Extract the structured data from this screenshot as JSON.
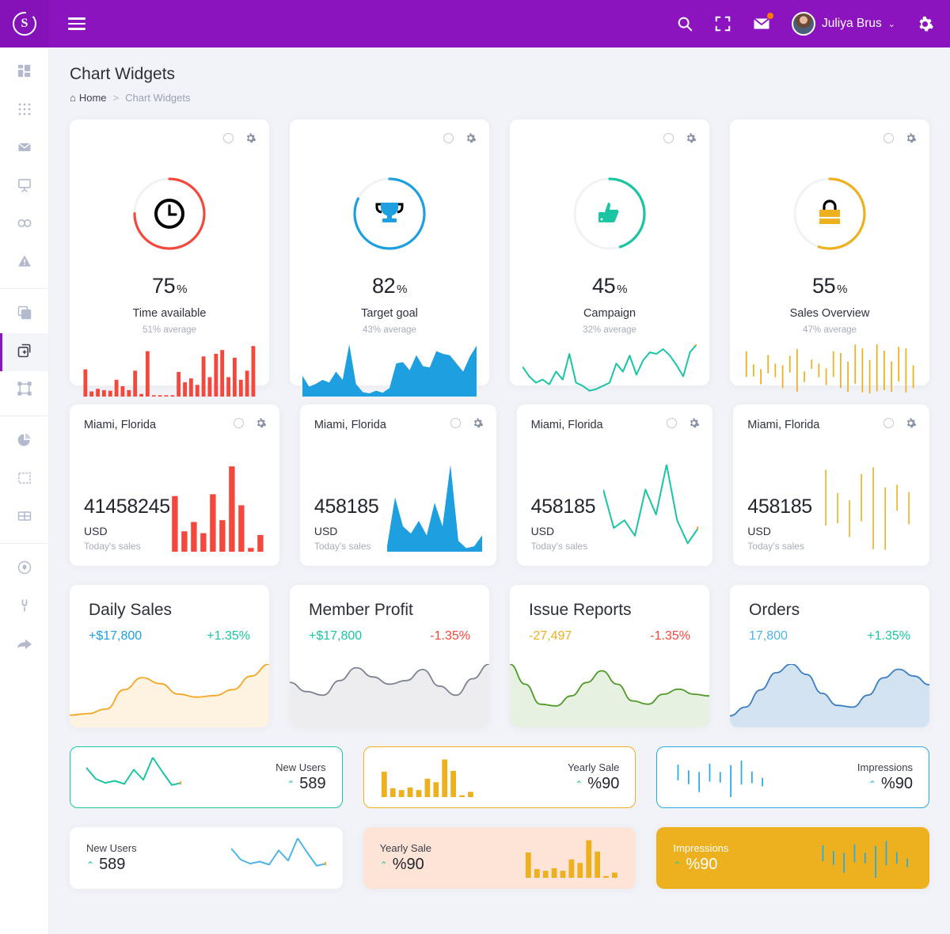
{
  "brand": {
    "logo_letter": "S",
    "primary": "#8c14bf"
  },
  "topbar": {
    "menu_toggle": "menu-toggle",
    "search_label": "Search",
    "fullscreen_label": "Fullscreen",
    "mail_label": "Messages",
    "user_name": "Juliya Brus",
    "caret": "⌄",
    "settings_label": "Settings"
  },
  "sidebar": {
    "items": [
      {
        "name": "dashboard",
        "icon": "layout-dashboard-icon",
        "active": false
      },
      {
        "name": "apps-grid",
        "icon": "grid-apps-icon",
        "active": false
      },
      {
        "name": "mail",
        "icon": "envelope-icon",
        "active": false
      },
      {
        "name": "presentation",
        "icon": "presentation-board-icon",
        "active": false
      },
      {
        "name": "infinity",
        "icon": "infinity-icon",
        "active": false
      },
      {
        "name": "alerts",
        "icon": "warning-triangle-icon",
        "active": false
      },
      {
        "name": "layers",
        "icon": "copy-layers-icon",
        "active": false
      },
      {
        "name": "widgets",
        "icon": "widget-copy-icon",
        "active": true
      },
      {
        "name": "components",
        "icon": "bounding-box-icon",
        "active": false
      },
      {
        "name": "charts",
        "icon": "pie-chart-icon",
        "active": false
      },
      {
        "name": "media",
        "icon": "image-frame-icon",
        "active": false
      },
      {
        "name": "tables",
        "icon": "table-grid-icon",
        "active": false
      },
      {
        "name": "maps",
        "icon": "location-pin-icon",
        "active": false
      },
      {
        "name": "plugins",
        "icon": "plug-icon",
        "active": false
      },
      {
        "name": "share",
        "icon": "arrow-share-icon",
        "active": false
      }
    ]
  },
  "page": {
    "title": "Chart Widgets",
    "breadcrumb": {
      "home": "Home",
      "separator": ">",
      "current": "Chart Widgets"
    }
  },
  "gauge_cards": [
    {
      "value": "75",
      "unit": "%",
      "label": "Time available",
      "sub": "51% average",
      "color": "#f4483c",
      "icon": "clock-icon",
      "percent": 75,
      "spark_type": "bar"
    },
    {
      "value": "82",
      "unit": "%",
      "label": "Target goal",
      "sub": "43% average",
      "color": "#1d9fe0",
      "icon": "trophy-icon",
      "percent": 82,
      "spark_type": "area"
    },
    {
      "value": "45",
      "unit": "%",
      "label": "Campaign",
      "sub": "32% average",
      "color": "#1bc5a3",
      "icon": "thumbs-up-icon",
      "percent": 45,
      "spark_type": "line"
    },
    {
      "value": "55",
      "unit": "%",
      "label": "Sales Overview",
      "sub": "47% average",
      "color": "#edb01f",
      "icon": "shopping-bag-icon",
      "percent": 55,
      "spark_type": "candle"
    }
  ],
  "sales_cards": [
    {
      "city": "Miami, Florida",
      "amount": "41458245",
      "currency": "USD",
      "sub": "Today's sales",
      "color": "#f4483c",
      "chart": "bar"
    },
    {
      "city": "Miami, Florida",
      "amount": "458185",
      "currency": "USD",
      "sub": "Today's sales",
      "color": "#1d9fe0",
      "chart": "area"
    },
    {
      "city": "Miami, Florida",
      "amount": "458185",
      "currency": "USD",
      "sub": "Today's sales",
      "color": "#1bc5a3",
      "chart": "line"
    },
    {
      "city": "Miami, Florida",
      "amount": "458185",
      "currency": "USD",
      "sub": "Today's sales",
      "color": "#edb01f",
      "chart": "candle"
    }
  ],
  "metric_cards": [
    {
      "title": "Daily Sales",
      "value": "+$17,800",
      "value_color": "#1d9fe0",
      "change": "+1.35%",
      "change_color": "#1bc5a3",
      "line_color": "#f5a623",
      "fill": "rgba(245,166,35,0.14)"
    },
    {
      "title": "Member Profit",
      "value": "+$17,800",
      "value_color": "#1bc5a3",
      "change": "-1.35%",
      "change_color": "#f4483c",
      "line_color": "#7e8391",
      "fill": "rgba(126,131,145,0.14)"
    },
    {
      "title": "Issue Reports",
      "value": "-27,497",
      "value_color": "#edb01f",
      "change": "-1.35%",
      "change_color": "#f4483c",
      "line_color": "#4f9a28",
      "fill": "rgba(79,154,40,0.14)"
    },
    {
      "title": "Orders",
      "value": "17,800",
      "value_color": "#4eb4e8",
      "change": "+1.35%",
      "change_color": "#1bc5a3",
      "line_color": "#3a7fc4",
      "fill": "rgba(58,127,196,0.22)"
    }
  ],
  "mini_outline_cards": [
    {
      "label": "New Users",
      "value": "589",
      "caret": "⌃",
      "border": "#1bc5a3",
      "chart_color": "#1bc5a3",
      "chart": "line",
      "bg": "#ffffff",
      "text_color": "#23252f",
      "label_color": "#3a3d4a"
    },
    {
      "label": "Yearly Sale",
      "value": "%90",
      "caret": "⌃",
      "border": "#edb01f",
      "chart_color": "#edb01f",
      "chart": "bar",
      "bg": "#ffffff",
      "text_color": "#23252f",
      "label_color": "#3a3d4a"
    },
    {
      "label": "Impressions",
      "value": "%90",
      "caret": "⌃",
      "border": "#29aae3",
      "chart_color": "#29aae3",
      "chart": "candle",
      "bg": "#ffffff",
      "text_color": "#23252f",
      "label_color": "#3a3d4a"
    }
  ],
  "mini_filled_cards": [
    {
      "label": "New Users",
      "value": "589",
      "caret": "⌃",
      "bg": "#ffffff",
      "chart_color": "#4eb4e8",
      "chart": "line",
      "text_color": "#23252f",
      "label_color": "#3a3d4a"
    },
    {
      "label": "Yearly Sale",
      "value": "%90",
      "caret": "⌃",
      "bg": "#fde4d6",
      "chart_color": "#edb01f",
      "chart": "bar",
      "text_color": "#23252f",
      "label_color": "#3a3d4a"
    },
    {
      "label": "Impressions",
      "value": "%90",
      "caret": "⌃",
      "bg": "#edb01f",
      "chart_color": "#29aae3",
      "chart": "candle",
      "text_color": "#ffffff",
      "label_color": "#ffffff"
    }
  ],
  "chart_data": {
    "type": "bar",
    "title": "Chart Widgets dashboard sparklines",
    "gauges": [
      {
        "name": "Time available",
        "percent": 75,
        "average": 51
      },
      {
        "name": "Target goal",
        "percent": 82,
        "average": 43
      },
      {
        "name": "Campaign",
        "percent": 45,
        "average": 32
      },
      {
        "name": "Sales Overview",
        "percent": 55,
        "average": 47
      }
    ],
    "sparkline_series": [
      {
        "name": "Time available bars",
        "type": "bar",
        "color": "#f4483c",
        "values": [
          42,
          8,
          12,
          10,
          9,
          26,
          16,
          10,
          40,
          4,
          70,
          2,
          2,
          2,
          2,
          38,
          22,
          28,
          18,
          62,
          30,
          66,
          72,
          30,
          60,
          26,
          40,
          78
        ]
      },
      {
        "name": "Target goal area",
        "type": "area",
        "color": "#1d9fe0",
        "values": [
          28,
          12,
          16,
          22,
          18,
          34,
          22,
          74,
          16,
          4,
          2,
          6,
          3,
          10,
          46,
          48,
          36,
          58,
          42,
          40,
          64,
          60,
          58,
          46,
          34,
          56,
          72
        ]
      },
      {
        "name": "Campaign line",
        "type": "line",
        "color": "#1bc5a3",
        "values": [
          34,
          22,
          14,
          18,
          12,
          28,
          18,
          50,
          14,
          10,
          4,
          6,
          10,
          14,
          38,
          28,
          48,
          24,
          42,
          52,
          50,
          56,
          48,
          36,
          22,
          52,
          62
        ]
      },
      {
        "name": "Sales Overview candles",
        "type": "candle",
        "color": "#edb01f",
        "values": [
          34,
          16,
          20,
          24,
          18,
          30,
          22,
          56,
          14,
          12,
          18,
          22,
          34,
          46,
          40,
          52,
          58,
          44,
          62,
          52,
          40,
          46,
          58,
          30
        ]
      },
      {
        "name": "Today's sales bars",
        "type": "bar",
        "color": "#f4483c",
        "values": [
          60,
          22,
          32,
          20,
          62,
          34,
          92,
          50,
          4,
          18
        ]
      },
      {
        "name": "Today's sales area",
        "type": "area",
        "color": "#1d9fe0",
        "values": [
          4,
          58,
          26,
          18,
          32,
          16,
          52,
          26,
          94,
          10,
          2,
          4,
          16
        ]
      },
      {
        "name": "Today's sales line",
        "type": "line",
        "color": "#1bc5a3",
        "values": [
          62,
          22,
          30,
          14,
          62,
          36,
          88,
          30,
          6,
          22
        ]
      },
      {
        "name": "Today's sales candles",
        "type": "candle",
        "color": "#edb01f",
        "values": [
          52,
          28,
          34,
          44,
          76,
          58,
          24,
          30
        ]
      },
      {
        "name": "Daily Sales curve",
        "type": "area",
        "color": "#f5a623",
        "values": [
          10,
          12,
          18,
          44,
          60,
          52,
          38,
          34,
          36,
          44,
          62,
          78
        ]
      },
      {
        "name": "Member Profit curve",
        "type": "area",
        "color": "#7e8391",
        "values": [
          44,
          34,
          30,
          46,
          60,
          50,
          42,
          46,
          58,
          40,
          30,
          48,
          64
        ]
      },
      {
        "name": "Issue Reports curve",
        "type": "area",
        "color": "#4f9a28",
        "values": [
          70,
          46,
          22,
          20,
          32,
          48,
          62,
          46,
          26,
          22,
          34,
          40,
          34,
          32
        ]
      },
      {
        "name": "Orders curve",
        "type": "area",
        "color": "#3a7fc4",
        "values": [
          8,
          18,
          38,
          58,
          68,
          56,
          34,
          20,
          18,
          32,
          52,
          62,
          54,
          44
        ]
      },
      {
        "name": "New Users line",
        "type": "line",
        "color": "#1bc5a3",
        "values": [
          52,
          30,
          22,
          26,
          20,
          48,
          28,
          72,
          44,
          18,
          22
        ]
      },
      {
        "name": "Yearly Sale bars",
        "type": "bar",
        "color": "#edb01f",
        "values": [
          58,
          20,
          16,
          22,
          16,
          42,
          34,
          86,
          60,
          4,
          12
        ]
      },
      {
        "name": "Impressions candles",
        "type": "candle",
        "color": "#29aae3",
        "values": [
          30,
          26,
          38,
          34,
          20,
          64,
          46,
          22,
          16
        ]
      }
    ],
    "xlabel": "",
    "ylabel": "",
    "grid": false,
    "legend": "none"
  }
}
